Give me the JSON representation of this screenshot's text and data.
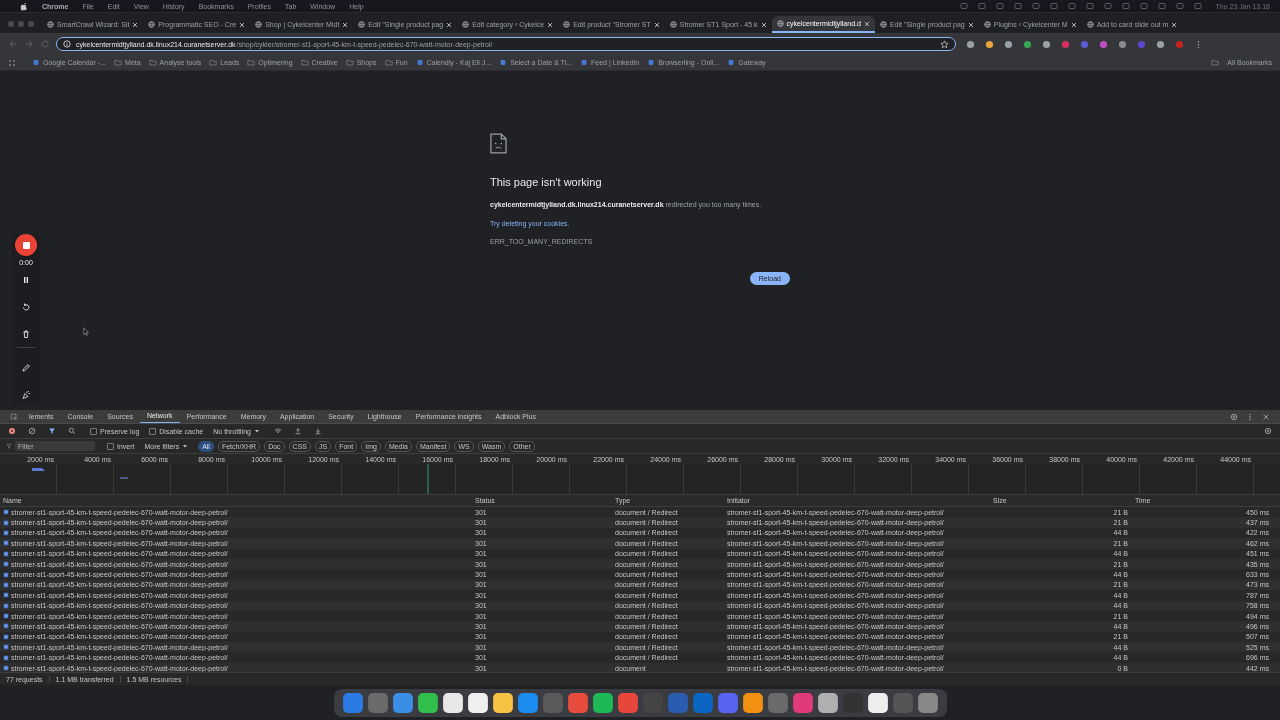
{
  "menu_bar": {
    "items": [
      "Chrome",
      "File",
      "Edit",
      "View",
      "History",
      "Bookmarks",
      "Profiles",
      "Tab",
      "Window",
      "Help"
    ],
    "clock": "Thu 23 Jan 13.18"
  },
  "tabs": [
    {
      "title": "SmartCrawl Wizard: Sit",
      "selected": false
    },
    {
      "title": "Programmatic SEO - Cre",
      "selected": false
    },
    {
      "title": "Shop | Cykelcenter Midt",
      "selected": false
    },
    {
      "title": "Edit \"Single product pag",
      "selected": false
    },
    {
      "title": "Edit category ‹ Cykelce",
      "selected": false
    },
    {
      "title": "Edit product \"Stromer ST",
      "selected": false
    },
    {
      "title": "Stromer ST1 Sport - 45 k",
      "selected": false
    },
    {
      "title": "cykelcentermidtjylland.d",
      "selected": true
    },
    {
      "title": "Edit \"Single product pag",
      "selected": false
    },
    {
      "title": "Plugins ‹ Cykelcenter M",
      "selected": false
    },
    {
      "title": "Add to card slide out m",
      "selected": false
    }
  ],
  "address_bar": {
    "host": "cykelcentermidtjylland.dk.linux214.curanetserver.dk",
    "path": "/shop/cykler/stromer-st1-sport-45-km-t-speed-pedelec-670-watt-motor-deep-petrol/"
  },
  "bookmarks": [
    {
      "label": "Google Calendar -...",
      "kind": "site"
    },
    {
      "label": "Meta",
      "kind": "folder"
    },
    {
      "label": "Analyse tools",
      "kind": "folder"
    },
    {
      "label": "Leads",
      "kind": "folder"
    },
    {
      "label": "Optimering",
      "kind": "folder"
    },
    {
      "label": "Creative",
      "kind": "folder"
    },
    {
      "label": "Shops",
      "kind": "folder"
    },
    {
      "label": "Fun",
      "kind": "folder"
    },
    {
      "label": "Calendly - Kaj Eli J...",
      "kind": "site"
    },
    {
      "label": "Select a Date & Ti...",
      "kind": "site"
    },
    {
      "label": "Feed | LinkedIn",
      "kind": "site"
    },
    {
      "label": "Browserling - Onli...",
      "kind": "site"
    },
    {
      "label": "Gateway",
      "kind": "site"
    }
  ],
  "all_bookmarks": "All Bookmarks",
  "error_page": {
    "title": "This page isn't working",
    "message": "**cykelcentermidtjylland.dk.linux214.curanetserver.dk** redirected you too many times.",
    "link": "Try deleting your cookies.",
    "code": "ERR_TOO_MANY_REDIRECTS",
    "button": "Reload"
  },
  "recorder": {
    "time": "0:00"
  },
  "devtools": {
    "tabs": [
      {
        "label": "lements",
        "selected": false
      },
      {
        "label": "Console",
        "selected": false
      },
      {
        "label": "Sources",
        "selected": false
      },
      {
        "label": "Network",
        "selected": true
      },
      {
        "label": "Performance",
        "selected": false
      },
      {
        "label": "Memory",
        "selected": false
      },
      {
        "label": "Application",
        "selected": false
      },
      {
        "label": "Security",
        "selected": false
      },
      {
        "label": "Lighthouse",
        "selected": false
      },
      {
        "label": "Performance insights",
        "selected": false
      },
      {
        "label": "Adblock Plus",
        "selected": false
      }
    ],
    "preserve_log": {
      "label": "Preserve log",
      "checked": false
    },
    "disable_cache": {
      "label": "Disable cache",
      "checked": false
    },
    "throttling": "No throttling",
    "filter_placeholder": "Filter",
    "invert": {
      "label": "Invert",
      "checked": false
    },
    "more_filters": "More filters",
    "type_filters": [
      {
        "label": "All",
        "selected": true
      },
      {
        "label": "Fetch/XHR",
        "selected": false
      },
      {
        "label": "Doc",
        "selected": false
      },
      {
        "label": "CSS",
        "selected": false
      },
      {
        "label": "JS",
        "selected": false
      },
      {
        "label": "Font",
        "selected": false
      },
      {
        "label": "Img",
        "selected": false
      },
      {
        "label": "Media",
        "selected": false
      },
      {
        "label": "Manifest",
        "selected": false
      },
      {
        "label": "WS",
        "selected": false
      },
      {
        "label": "Wasm",
        "selected": false
      },
      {
        "label": "Other",
        "selected": false
      }
    ],
    "timeline_ticks": [
      "2000 ms",
      "4000 ms",
      "6000 ms",
      "8000 ms",
      "10000 ms",
      "12000 ms",
      "14000 ms",
      "16000 ms",
      "18000 ms",
      "20000 ms",
      "22000 ms",
      "24000 ms",
      "26000 ms",
      "28000 ms",
      "30000 ms",
      "32000 ms",
      "34000 ms",
      "36000 ms",
      "38000 ms",
      "40000 ms",
      "42000 ms",
      "44000 ms"
    ],
    "columns": [
      "Name",
      "Status",
      "Type",
      "Initiator",
      "Size",
      "Time"
    ],
    "rows": [
      {
        "name": "stromer-st1-sport-45-km-t-speed-pedelec-670-watt-motor-deep-petrol/",
        "status": "301",
        "type": "document / Redirect",
        "initiator": "stromer-st1-sport-45-km-t-speed-pedelec-670-watt-motor-deep-petrol/",
        "size": "21 B",
        "time": "450 ms"
      },
      {
        "name": "stromer-st1-sport-45-km-t-speed-pedelec-670-watt-motor-deep-petrol/",
        "status": "301",
        "type": "document / Redirect",
        "initiator": "stromer-st1-sport-45-km-t-speed-pedelec-670-watt-motor-deep-petrol/",
        "size": "21 B",
        "time": "437 ms"
      },
      {
        "name": "stromer-st1-sport-45-km-t-speed-pedelec-670-watt-motor-deep-petrol/",
        "status": "301",
        "type": "document / Redirect",
        "initiator": "stromer-st1-sport-45-km-t-speed-pedelec-670-watt-motor-deep-petrol/",
        "size": "44 B",
        "time": "422 ms"
      },
      {
        "name": "stromer-st1-sport-45-km-t-speed-pedelec-670-watt-motor-deep-petrol/",
        "status": "301",
        "type": "document / Redirect",
        "initiator": "stromer-st1-sport-45-km-t-speed-pedelec-670-watt-motor-deep-petrol/",
        "size": "21 B",
        "time": "462 ms"
      },
      {
        "name": "stromer-st1-sport-45-km-t-speed-pedelec-670-watt-motor-deep-petrol/",
        "status": "301",
        "type": "document / Redirect",
        "initiator": "stromer-st1-sport-45-km-t-speed-pedelec-670-watt-motor-deep-petrol/",
        "size": "44 B",
        "time": "451 ms"
      },
      {
        "name": "stromer-st1-sport-45-km-t-speed-pedelec-670-watt-motor-deep-petrol/",
        "status": "301",
        "type": "document / Redirect",
        "initiator": "stromer-st1-sport-45-km-t-speed-pedelec-670-watt-motor-deep-petrol/",
        "size": "21 B",
        "time": "435 ms"
      },
      {
        "name": "stromer-st1-sport-45-km-t-speed-pedelec-670-watt-motor-deep-petrol/",
        "status": "301",
        "type": "document / Redirect",
        "initiator": "stromer-st1-sport-45-km-t-speed-pedelec-670-watt-motor-deep-petrol/",
        "size": "44 B",
        "time": "633 ms"
      },
      {
        "name": "stromer-st1-sport-45-km-t-speed-pedelec-670-watt-motor-deep-petrol/",
        "status": "301",
        "type": "document / Redirect",
        "initiator": "stromer-st1-sport-45-km-t-speed-pedelec-670-watt-motor-deep-petrol/",
        "size": "21 B",
        "time": "473 ms"
      },
      {
        "name": "stromer-st1-sport-45-km-t-speed-pedelec-670-watt-motor-deep-petrol/",
        "status": "301",
        "type": "document / Redirect",
        "initiator": "stromer-st1-sport-45-km-t-speed-pedelec-670-watt-motor-deep-petrol/",
        "size": "44 B",
        "time": "787 ms"
      },
      {
        "name": "stromer-st1-sport-45-km-t-speed-pedelec-670-watt-motor-deep-petrol/",
        "status": "301",
        "type": "document / Redirect",
        "initiator": "stromer-st1-sport-45-km-t-speed-pedelec-670-watt-motor-deep-petrol/",
        "size": "44 B",
        "time": "758 ms"
      },
      {
        "name": "stromer-st1-sport-45-km-t-speed-pedelec-670-watt-motor-deep-petrol/",
        "status": "301",
        "type": "document / Redirect",
        "initiator": "stromer-st1-sport-45-km-t-speed-pedelec-670-watt-motor-deep-petrol/",
        "size": "21 B",
        "time": "494 ms"
      },
      {
        "name": "stromer-st1-sport-45-km-t-speed-pedelec-670-watt-motor-deep-petrol/",
        "status": "301",
        "type": "document / Redirect",
        "initiator": "stromer-st1-sport-45-km-t-speed-pedelec-670-watt-motor-deep-petrol/",
        "size": "44 B",
        "time": "496 ms"
      },
      {
        "name": "stromer-st1-sport-45-km-t-speed-pedelec-670-watt-motor-deep-petrol/",
        "status": "301",
        "type": "document / Redirect",
        "initiator": "stromer-st1-sport-45-km-t-speed-pedelec-670-watt-motor-deep-petrol/",
        "size": "21 B",
        "time": "507 ms"
      },
      {
        "name": "stromer-st1-sport-45-km-t-speed-pedelec-670-watt-motor-deep-petrol/",
        "status": "301",
        "type": "document / Redirect",
        "initiator": "stromer-st1-sport-45-km-t-speed-pedelec-670-watt-motor-deep-petrol/",
        "size": "44 B",
        "time": "525 ms"
      },
      {
        "name": "stromer-st1-sport-45-km-t-speed-pedelec-670-watt-motor-deep-petrol/",
        "status": "301",
        "type": "document / Redirect",
        "initiator": "stromer-st1-sport-45-km-t-speed-pedelec-670-watt-motor-deep-petrol/",
        "size": "44 B",
        "time": "696 ms"
      },
      {
        "name": "stromer-st1-sport-45-km-t-speed-pedelec-670-watt-motor-deep-petrol/",
        "status": "301",
        "type": "document",
        "initiator": "stromer-st1-sport-45-km-t-speed-pedelec-670-watt-motor-deep-petrol/",
        "size": "0 B",
        "time": "442 ms"
      }
    ],
    "summary": [
      "77 requests",
      "1.1 MB transferred",
      "1.5 MB resources"
    ]
  }
}
